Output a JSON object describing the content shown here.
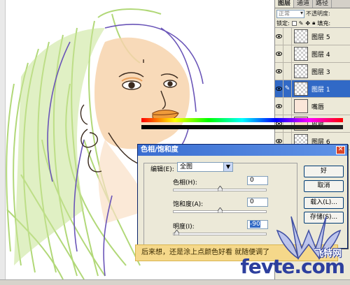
{
  "layers_panel": {
    "tabs": [
      "图层",
      "通道",
      "路径"
    ],
    "blend_mode": "正常",
    "opacity_label": "不透明度:",
    "lock_label": "锁定:",
    "fill_label": "填充:",
    "layers": [
      {
        "name": "图层 5",
        "visible": true,
        "selected": false
      },
      {
        "name": "图层 4",
        "visible": true,
        "selected": false
      },
      {
        "name": "图层 3",
        "visible": true,
        "selected": false
      },
      {
        "name": "图层 1",
        "visible": true,
        "selected": true
      },
      {
        "name": "嘴唇",
        "visible": true,
        "selected": false
      },
      {
        "name": "皮肤",
        "visible": true,
        "selected": false
      },
      {
        "name": "图层 6",
        "visible": true,
        "selected": false
      }
    ]
  },
  "dialog": {
    "title": "色相/饱和度",
    "edit_label": "编辑(E):",
    "edit_value": "全图",
    "hue_label": "色相(H):",
    "hue_value": "0",
    "saturation_label": "饱和度(A):",
    "saturation_value": "0",
    "lightness_label": "明度(I):",
    "lightness_value": "-90",
    "buttons": {
      "ok": "好",
      "cancel": "取消",
      "load": "载入(L)...",
      "save": "存储(S)..."
    }
  },
  "caption": "后来想，还是涂上点颜色好看 就随便调了",
  "watermark": {
    "brand_cn": "飞特网",
    "url": "fevte.com"
  },
  "colors": {
    "selection_blue": "#3169c6",
    "dialog_title": "#3a6ed1",
    "hair_green": "#a9d46a",
    "skin": "#f7d3ad",
    "lips": "#ee9a3a"
  }
}
